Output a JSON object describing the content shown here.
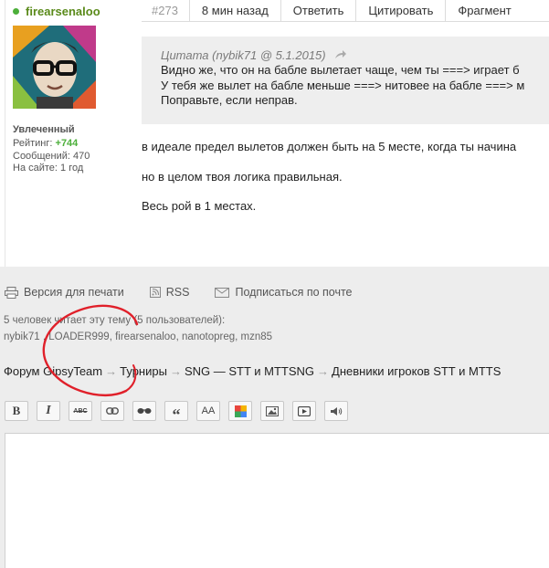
{
  "author": {
    "name": "firearsenaloo",
    "rank": "Увлеченный",
    "rating_label": "Рейтинг:",
    "rating_value": "+744",
    "messages": "Сообщений: 470",
    "on_site": "На сайте: 1 год",
    "online_color": "#4caf3a"
  },
  "post_bar": {
    "number": "#273",
    "time": "8 мин назад",
    "reply": "Ответить",
    "quote": "Цитировать",
    "fragment": "Фрагмент"
  },
  "quote": {
    "header": "Цитата (nybik71 @ 5.1.2015)",
    "lines": [
      "Видно же, что он на бабле вылетает чаще, чем ты ===> играет б",
      "У тебя же вылет на бабле меньше ===> нитовее на бабле ===> м",
      "Поправьте, если неправ."
    ]
  },
  "post_text": [
    "в идеале предел вылетов должен быть на 5 месте, когда ты начина",
    "но в целом твоя логика правильная.",
    "Весь рой в 1 местах."
  ],
  "tools": {
    "print": "Версия для печати",
    "rss": "RSS",
    "subscribe": "Подписаться по почте"
  },
  "readers": {
    "summary": "5 человек читает эту тему (5 пользователей):",
    "list": "nybik71 , LOADER999, firearsenaloo, nanotopreg, mzn85"
  },
  "breadcrumb": [
    "Форум GipsyTeam",
    "Турниры",
    "SNG — STT и MTTSNG",
    "Дневники игроков STT и MTTS"
  ],
  "breadcrumb_sep": "→",
  "editor_toolbar": {
    "bold": "B",
    "italic": "I",
    "strike": "ABC",
    "size": "AA"
  },
  "colors": {
    "accent_green": "#5a8a1a",
    "footer_bg": "#ededed",
    "quote_bg": "#eeeeee",
    "annotation_red": "#e0202a"
  }
}
